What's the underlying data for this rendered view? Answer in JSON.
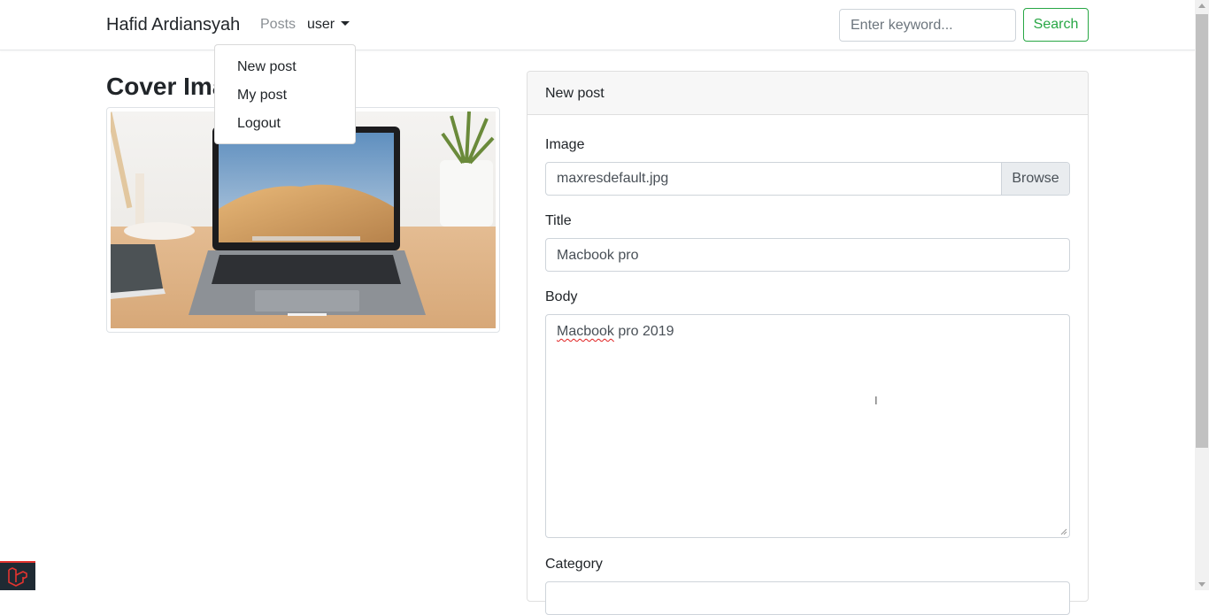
{
  "navbar": {
    "brand": "Hafid Ardiansyah",
    "posts_link": "Posts",
    "user_menu": "user",
    "search_placeholder": "Enter keyword...",
    "search_button": "Search"
  },
  "dropdown": {
    "items": [
      "New post",
      "My post",
      "Logout"
    ]
  },
  "cover": {
    "title": "Cover Image",
    "image_icon": "laptop-photo"
  },
  "form": {
    "header": "New post",
    "image_label": "Image",
    "image_file": "maxresdefault.jpg",
    "browse_label": "Browse",
    "title_label": "Title",
    "title_value": "Macbook pro",
    "body_label": "Body",
    "body_word_1": "Macbook",
    "body_rest": " pro 2019",
    "category_label": "Category"
  },
  "colors": {
    "accent_green": "#28a745",
    "badge_red": "#e3342f"
  }
}
